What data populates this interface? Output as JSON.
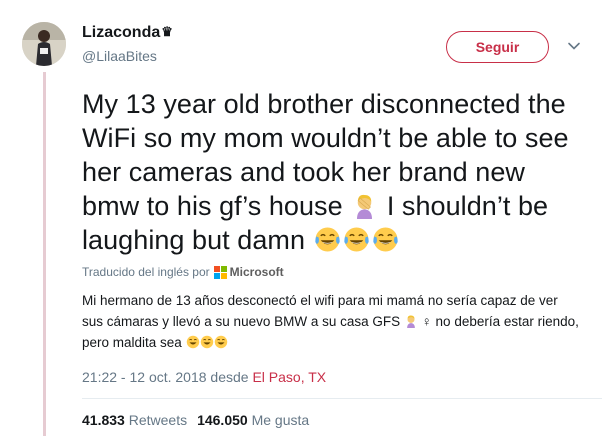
{
  "author": {
    "display_name": "Lizaconda",
    "badge_icon": "crown-icon",
    "badge_glyph": "♛",
    "handle": "@LilaaBites"
  },
  "follow_label": "Seguir",
  "tweet": {
    "line1": "My 13 year old brother disconnected the",
    "line2": "WiFi so my mom wouldn’t be able to see",
    "line3": "her cameras and took her brand new",
    "line4_pre": "bmw to his gf’s house",
    "line4_post": "I shouldn’t be",
    "line5": "laughing but damn"
  },
  "translation_credit": {
    "prefix": "Traducido del inglés por",
    "provider": "Microsoft"
  },
  "translation": {
    "line1": "Mi hermano de 13 años desconectó el wifi para mi mamá no sería capaz de ver",
    "line2_pre": "sus cámaras y llevó a su nuevo BMW a su casa GFS",
    "line2_post": "no debería estar riendo,",
    "female_sign": "♀",
    "line3": "pero maldita sea"
  },
  "timestamp": "21:22 - 12 oct. 2018 desde",
  "location": "El Paso, TX",
  "stats": {
    "retweets_count": "41.833",
    "retweets_label": "Retweets",
    "likes_count": "146.050",
    "likes_label": "Me gusta"
  },
  "colors": {
    "accent": "#c82f48",
    "muted": "#657786",
    "thread_line": "#e6cbd2"
  }
}
